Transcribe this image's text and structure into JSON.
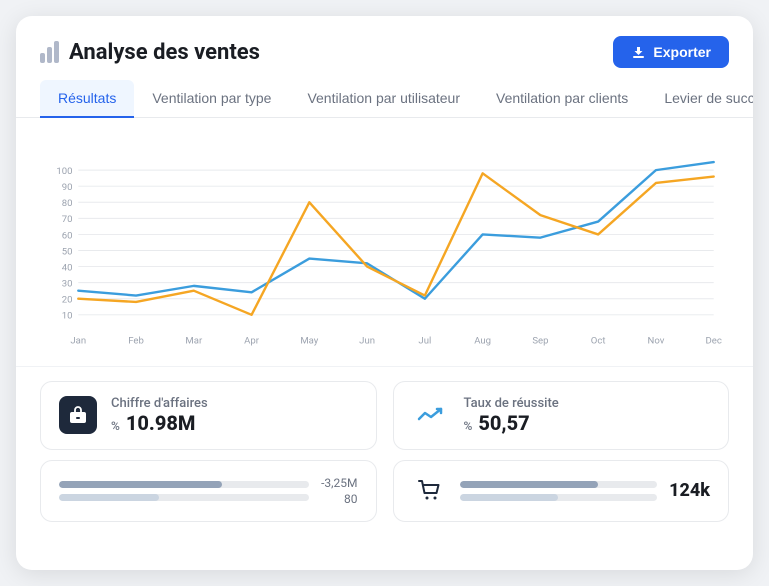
{
  "header": {
    "title": "Analyse des ventes",
    "export_label": "Exporter"
  },
  "tabs": [
    {
      "id": "resultats",
      "label": "Résultats",
      "active": true
    },
    {
      "id": "ventilation-type",
      "label": "Ventilation par type",
      "active": false
    },
    {
      "id": "ventilation-utilisateur",
      "label": "Ventilation par utilisateur",
      "active": false
    },
    {
      "id": "ventilation-clients",
      "label": "Ventilation par clients",
      "active": false
    },
    {
      "id": "levier-succes",
      "label": "Levier de succès",
      "active": false
    }
  ],
  "chart": {
    "x_labels": [
      "Jan",
      "Feb",
      "Mar",
      "Apr",
      "May",
      "Jun",
      "Jul",
      "Aug",
      "Sep",
      "Oct",
      "Nov",
      "Dec"
    ],
    "y_labels": [
      "10",
      "20",
      "30",
      "40",
      "50",
      "60",
      "70",
      "80",
      "90",
      "100"
    ],
    "series": {
      "blue": [
        25,
        22,
        28,
        24,
        45,
        42,
        20,
        60,
        58,
        68,
        100,
        105
      ],
      "orange": [
        20,
        18,
        25,
        10,
        80,
        40,
        22,
        98,
        72,
        60,
        92,
        96
      ]
    },
    "colors": {
      "blue": "#3b9ddd",
      "orange": "#f5a623"
    }
  },
  "stats": [
    {
      "id": "chiffre-affaires",
      "icon": "briefcase",
      "label": "Chiffre d'affaires",
      "percent_label": "%",
      "value": "10.98M"
    },
    {
      "id": "taux-reussite",
      "icon": "trend",
      "label": "Taux de réussite",
      "percent_label": "%",
      "value": "50,57"
    }
  ],
  "bottom": {
    "left": {
      "bar1_width": "65",
      "bar1_color": "#94a3b8",
      "bar2_width": "40",
      "bar2_color": "#cbd5e1",
      "sub_value1": "-3,25M",
      "sub_value2": "80"
    },
    "right": {
      "value": "124k"
    }
  }
}
